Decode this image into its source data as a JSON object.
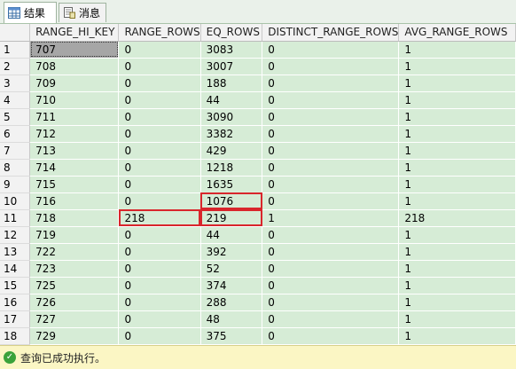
{
  "tabs": [
    {
      "label": "结果",
      "icon": "grid-icon",
      "active": true
    },
    {
      "label": "消息",
      "icon": "messages-icon",
      "active": false
    }
  ],
  "grid": {
    "columns": [
      "",
      "RANGE_HI_KEY",
      "RANGE_ROWS",
      "EQ_ROWS",
      "DISTINCT_RANGE_ROWS",
      "AVG_RANGE_ROWS"
    ],
    "rows": [
      [
        "1",
        "707",
        "0",
        "3083",
        "0",
        "1"
      ],
      [
        "2",
        "708",
        "0",
        "3007",
        "0",
        "1"
      ],
      [
        "3",
        "709",
        "0",
        "188",
        "0",
        "1"
      ],
      [
        "4",
        "710",
        "0",
        "44",
        "0",
        "1"
      ],
      [
        "5",
        "711",
        "0",
        "3090",
        "0",
        "1"
      ],
      [
        "6",
        "712",
        "0",
        "3382",
        "0",
        "1"
      ],
      [
        "7",
        "713",
        "0",
        "429",
        "0",
        "1"
      ],
      [
        "8",
        "714",
        "0",
        "1218",
        "0",
        "1"
      ],
      [
        "9",
        "715",
        "0",
        "1635",
        "0",
        "1"
      ],
      [
        "10",
        "716",
        "0",
        "1076",
        "0",
        "1"
      ],
      [
        "11",
        "718",
        "218",
        "219",
        "1",
        "218"
      ],
      [
        "12",
        "719",
        "0",
        "44",
        "0",
        "1"
      ],
      [
        "13",
        "722",
        "0",
        "392",
        "0",
        "1"
      ],
      [
        "14",
        "723",
        "0",
        "52",
        "0",
        "1"
      ],
      [
        "15",
        "725",
        "0",
        "374",
        "0",
        "1"
      ],
      [
        "16",
        "726",
        "0",
        "288",
        "0",
        "1"
      ],
      [
        "17",
        "727",
        "0",
        "48",
        "0",
        "1"
      ],
      [
        "18",
        "729",
        "0",
        "375",
        "0",
        "1"
      ]
    ]
  },
  "status": {
    "text": "查询已成功执行。",
    "icon": "success-check-icon"
  },
  "colors": {
    "cell_bg": "#d6ecd6",
    "highlight": "#d9262c",
    "status_bg": "#fbf6c4"
  }
}
